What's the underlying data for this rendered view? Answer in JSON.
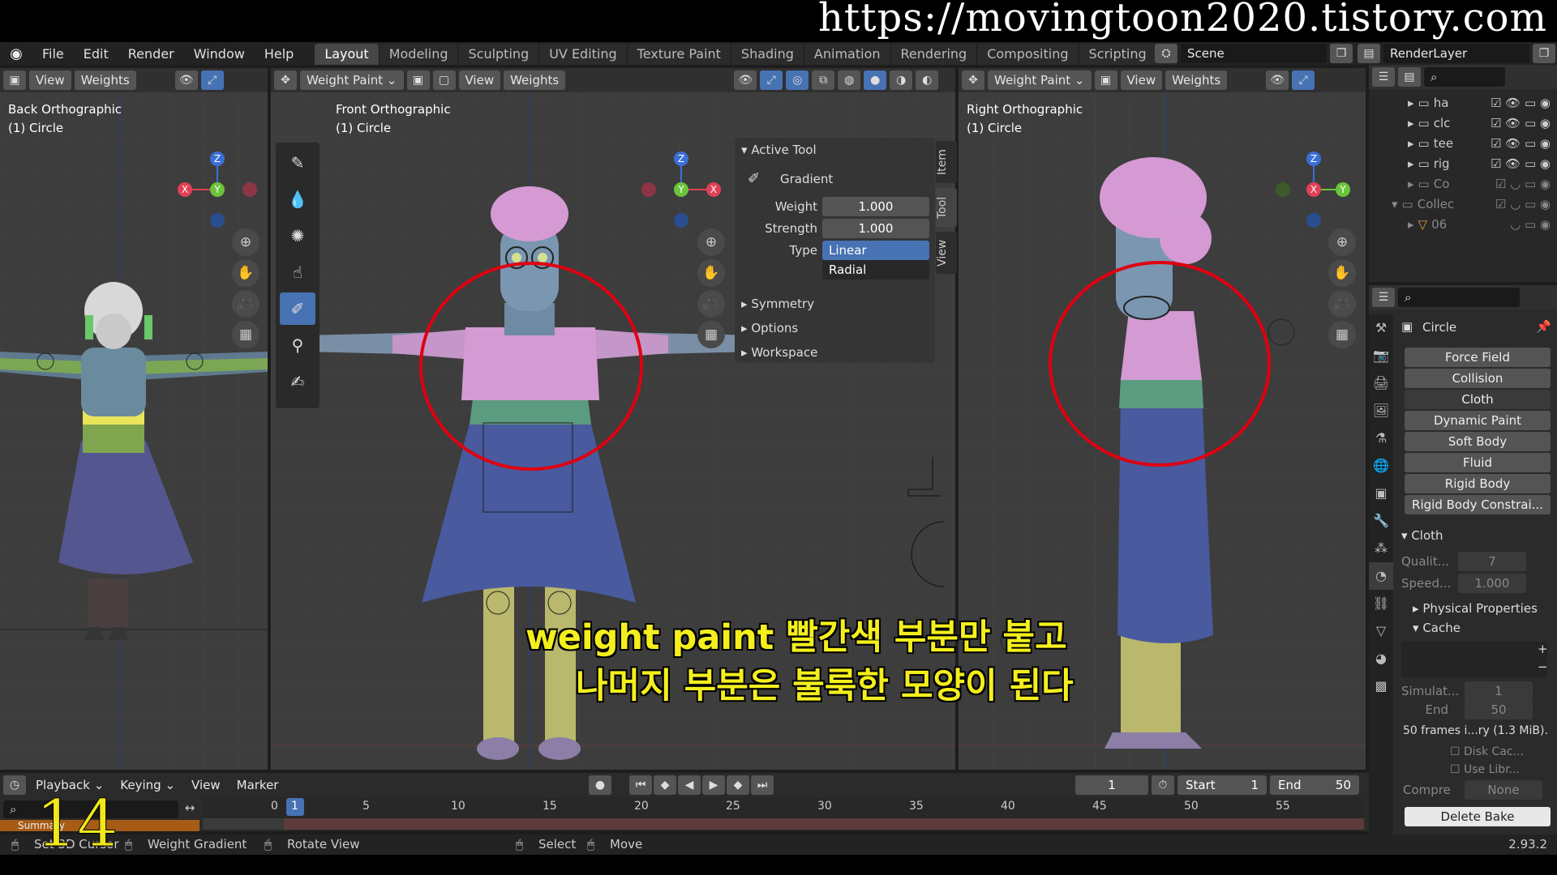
{
  "banner": {
    "url": "https://movingtoon2020.tistory.com"
  },
  "menu": [
    "File",
    "Edit",
    "Render",
    "Window",
    "Help"
  ],
  "workspaces": [
    "Layout",
    "Modeling",
    "Sculpting",
    "UV Editing",
    "Texture Paint",
    "Shading",
    "Animation",
    "Rendering",
    "Compositing",
    "Scripting"
  ],
  "active_workspace": "Layout",
  "scene": "Scene",
  "render_layer": "RenderLayer",
  "viewports": {
    "left": {
      "view_label": "Back Orthographic",
      "object_label": "(1) Circle",
      "menus": [
        "View",
        "Weights"
      ]
    },
    "center": {
      "mode": "Weight Paint",
      "view_label": "Front Orthographic",
      "object_label": "(1) Circle",
      "menus": [
        "View",
        "Weights"
      ]
    },
    "right": {
      "mode": "Weight Paint",
      "view_label": "Right Orthographic",
      "object_label": "(1) Circle",
      "menus": [
        "View",
        "Weights"
      ]
    }
  },
  "gizmo_axes": {
    "x": "X",
    "y": "Y",
    "z": "Z"
  },
  "npanel": {
    "section": "Active Tool",
    "tool_name": "Gradient",
    "weight_label": "Weight",
    "weight_value": "1.000",
    "strength_label": "Strength",
    "strength_value": "1.000",
    "type_label": "Type",
    "type_options": [
      "Linear",
      "Radial"
    ],
    "type_selected": "Linear",
    "subpanels": [
      "Symmetry",
      "Options",
      "Workspace"
    ],
    "tabs": [
      "Item",
      "Tool",
      "View"
    ]
  },
  "outliner": {
    "rows": [
      {
        "name": "ha"
      },
      {
        "name": "clc"
      },
      {
        "name": "tee"
      },
      {
        "name": "rig"
      },
      {
        "name": "Co"
      },
      {
        "name": "Collec"
      },
      {
        "name": "06"
      }
    ]
  },
  "properties": {
    "object_name": "Circle",
    "physics_buttons": [
      "Force Field",
      "Collision",
      "Cloth",
      "Dynamic Paint",
      "Soft Body",
      "Fluid",
      "Rigid Body",
      "Rigid Body Constrai..."
    ],
    "cloth_section": "Cloth",
    "quality_label": "Qualit...",
    "quality_value": "7",
    "speed_label": "Speed...",
    "speed_value": "1.000",
    "physical_properties": "Physical Properties",
    "cache": "Cache",
    "simulate_label": "Simulat...",
    "simulate_value": "1",
    "end_label": "End",
    "end_value": "50",
    "cache_info": "50 frames i...ry (1.3 MiB).",
    "disk_cache": "Disk Cac...",
    "use_library": "Use Libr...",
    "compress_label": "Compre",
    "compress_value": "None",
    "delete_bake": "Delete Bake"
  },
  "timeline": {
    "menus": [
      "Playback",
      "Keying",
      "View",
      "Marker"
    ],
    "current_frame": "1",
    "start_label": "Start",
    "start_value": "1",
    "end_label": "End",
    "end_value": "50",
    "ruler": [
      "0",
      "1",
      "5",
      "10",
      "15",
      "20",
      "25",
      "30",
      "35",
      "40",
      "45",
      "50",
      "55"
    ],
    "summary": "Summary"
  },
  "status_bar": {
    "items": [
      "Set 3D Cursor",
      "Weight Gradient",
      "Rotate View",
      "Select",
      "Move"
    ],
    "version": "2.93.2"
  },
  "subtitle": {
    "line1": "weight paint 빨간색 부분만 붙고",
    "line2": "나머지 부분은 불룩한 모양이 된다"
  },
  "episode_number": "14",
  "colors": {
    "accent": "#4772b3",
    "red_circle": "#e00010",
    "subtitle": "#f4ef1c"
  }
}
